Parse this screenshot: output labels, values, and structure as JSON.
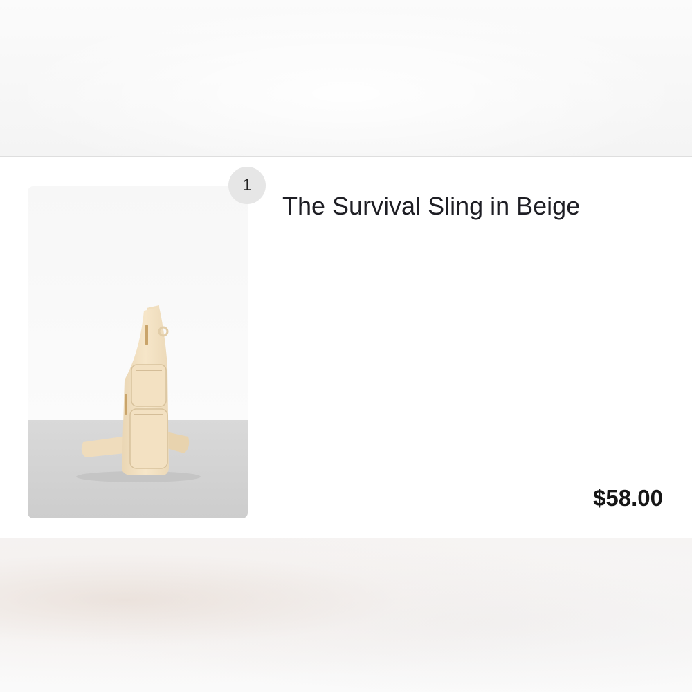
{
  "cart_item": {
    "quantity": "1",
    "title": "The Survival Sling in Beige",
    "price": "$58.00",
    "image_alt": "The Survival Sling in Beige"
  },
  "colors": {
    "bag_beige": "#f3e2c4",
    "floor_gray": "#d3d3d3",
    "badge_bg": "#e6e6e6"
  }
}
